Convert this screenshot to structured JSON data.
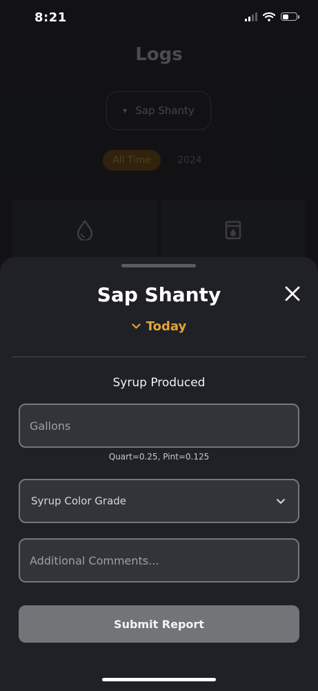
{
  "status_bar": {
    "time": "8:21",
    "icons": [
      "cellular-signal-icon",
      "wifi-icon",
      "battery-icon"
    ],
    "battery_level": 0.45
  },
  "background": {
    "title": "Logs",
    "dropdown_label": "Sap Shanty",
    "filters": [
      {
        "label": "All Time",
        "active": true
      },
      {
        "label": "2024",
        "active": false
      }
    ],
    "cards": [
      {
        "icon": "water-drop-icon"
      },
      {
        "icon": "syrup-jar-icon"
      }
    ]
  },
  "sheet": {
    "title": "Sap Shanty",
    "close_icon": "close-icon",
    "date_label": "Today",
    "section_label": "Syrup Produced",
    "gallons": {
      "value": "",
      "placeholder": "Gallons"
    },
    "helper_text": "Quart=0.25, Pint=0.125",
    "color_grade": {
      "selected": "Syrup Color Grade"
    },
    "comments": {
      "value": "",
      "placeholder": "Additional Comments..."
    },
    "submit_label": "Submit Report"
  },
  "colors": {
    "accent": "#e3a437",
    "sheet_bg": "#202126",
    "field_bg": "#33343a",
    "field_border": "#77787d",
    "button_bg": "#737478"
  }
}
